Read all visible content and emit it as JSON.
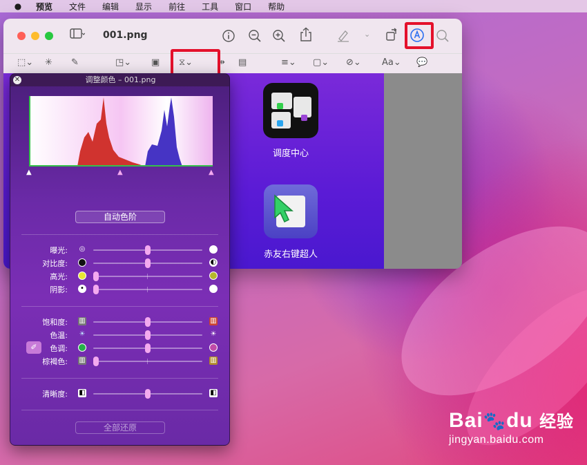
{
  "menubar": {
    "apple": "",
    "items": [
      "预览",
      "文件",
      "编辑",
      "显示",
      "前往",
      "工具",
      "窗口",
      "帮助"
    ]
  },
  "window": {
    "title": "001.png",
    "traffic_lights": {
      "close": "#ff5f57",
      "minimize": "#febc2e",
      "zoom": "#28c840"
    },
    "toolbar_icons": [
      "sidebar-icon",
      "info-icon",
      "zoom-out-icon",
      "zoom-in-icon",
      "share-icon",
      "highlight-icon",
      "rotate-icon",
      "markup-icon",
      "search-icon"
    ],
    "markup_tools": [
      "selection-icon",
      "magic-select-icon",
      "sketch-icon",
      "shapes-icon",
      "text-icon",
      "sign-icon",
      "adjust-color-icon",
      "page-layout-icon",
      "line-style-icon",
      "border-color-icon",
      "fill-color-icon",
      "text-style-icon",
      "annotate-icon"
    ],
    "text_style_label": "Aa"
  },
  "apps": [
    {
      "label": "调度中心"
    },
    {
      "label": "赤友右键超人"
    }
  ],
  "panel": {
    "title": "调整颜色 – 001.png",
    "auto_levels": "自动色阶",
    "reset_all": "全部还原",
    "rows": [
      {
        "label": "曝光:",
        "value": 0.5
      },
      {
        "label": "对比度:",
        "value": 0.5
      },
      {
        "label": "高光:",
        "value": 0.0
      },
      {
        "label": "阴影:",
        "value": 0.0
      },
      {
        "label": "饱和度:",
        "value": 0.5
      },
      {
        "label": "色温:",
        "value": 0.5
      },
      {
        "label": "色调:",
        "value": 0.5
      },
      {
        "label": "棕褐色:",
        "value": 0.0
      },
      {
        "label": "清晰度:",
        "value": 0.5
      }
    ]
  },
  "watermark": {
    "brand": "Bai",
    "du": "du",
    "cn": "经验",
    "url": "jingyan.baidu.com"
  },
  "colors": {
    "highlight_box": "#e4102b",
    "markup_active": "#2a6ef0",
    "slider_thumb": "#f3a9ef"
  }
}
